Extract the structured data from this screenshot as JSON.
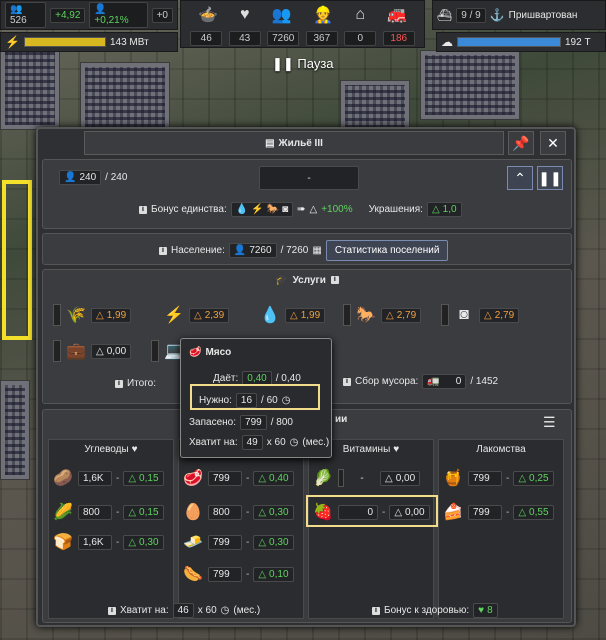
{
  "hud_left": {
    "items": [
      {
        "icon": "people-icon",
        "value": "526"
      },
      {
        "icon": "",
        "value": "+4,92"
      },
      {
        "icon": "person-icon",
        "value": "+0,21%"
      },
      {
        "icon": "",
        "value": "+0"
      }
    ],
    "power_value": "143 МВт"
  },
  "hud_center": {
    "icons": [
      "food-bowl-icon",
      "heart-icon",
      "people-group-icon",
      "worker-icon",
      "house-icon",
      "fire-truck-icon"
    ],
    "values": [
      "46",
      "43",
      "7260",
      "367",
      "0",
      "186"
    ]
  },
  "hud_right": {
    "ship_count": "9 / 9",
    "ship_status": "Пришвартован",
    "water_value": "192 Т"
  },
  "pause_label": "Пауза",
  "window": {
    "title": "Жильё III",
    "residents": "240",
    "residents_max": "/ 240",
    "name_field": "-",
    "unity_label": "Бонус единства:",
    "unity_value": "+100%",
    "decor_label": "Украшения:",
    "decor_value": "1,0",
    "population_label": "Население:",
    "population_value": "7260",
    "population_max": "/ 7260",
    "stats_button": "Статистика поселений",
    "services_title": "Услуги",
    "services": [
      {
        "icon": "grain-icon",
        "value": "1,99",
        "color": "orange"
      },
      {
        "icon": "lightning-icon",
        "value": "2,39",
        "color": "orange"
      },
      {
        "icon": "water-drops-icon",
        "value": "1,99",
        "color": "orange"
      },
      {
        "icon": "rocking-horse-icon",
        "value": "2,79",
        "color": "orange"
      },
      {
        "icon": "washing-machine-icon",
        "value": "2,79",
        "color": "orange"
      },
      {
        "icon": "medical-bag-icon",
        "value": "0,00",
        "color": "white"
      },
      {
        "icon": "laptop-icon",
        "value": "",
        "color": "white"
      }
    ],
    "total_label": "Итого:",
    "garbage_label": "Сбор мусора:",
    "garbage_value": "0",
    "garbage_max": "/ 1452",
    "food_title_tail": "ии",
    "food_columns": [
      {
        "title": "Углеводы",
        "rows": [
          {
            "icon": "potato-icon",
            "stock": "1,6K",
            "val": "0,15",
            "color": "green"
          },
          {
            "icon": "corn-icon",
            "stock": "800",
            "val": "0,15",
            "color": "green"
          },
          {
            "icon": "bread-icon",
            "stock": "1,6K",
            "val": "0,30",
            "color": "green"
          }
        ]
      },
      {
        "title": "",
        "rows": [
          {
            "icon": "meat-icon",
            "stock": "799",
            "val": "0,40",
            "color": "green"
          },
          {
            "icon": "eggs-icon",
            "stock": "800",
            "val": "0,30",
            "color": "green"
          },
          {
            "icon": "tofu-icon",
            "stock": "799",
            "val": "0,30",
            "color": "green"
          },
          {
            "icon": "sausage-icon",
            "stock": "799",
            "val": "0,10",
            "color": "green"
          }
        ]
      },
      {
        "title": "Витамины",
        "rows": [
          {
            "icon": "vegetables-icon",
            "stock": "-",
            "val": "0,00",
            "color": "white"
          },
          {
            "icon": "fruit-icon",
            "stock": "0",
            "val": "0,00",
            "color": "white"
          }
        ]
      },
      {
        "title": "Лакомства",
        "rows": [
          {
            "icon": "jam-icon",
            "stock": "799",
            "val": "0,25",
            "color": "green"
          },
          {
            "icon": "cake-icon",
            "stock": "799",
            "val": "0,55",
            "color": "green"
          }
        ]
      }
    ],
    "lasts_label": "Хватит на:",
    "lasts_value": "46",
    "lasts_max": "x 60",
    "lasts_unit": "(мес.)",
    "health_label": "Бонус к здоровью:",
    "health_value": "8"
  },
  "tooltip": {
    "title": "Мясо",
    "given_label": "Даёт:",
    "given_value": "0,40",
    "given_max": "/ 0,40",
    "needed_label": "Нужно:",
    "needed_value": "16",
    "needed_max": "/ 60",
    "stored_label": "Запасено:",
    "stored_value": "799",
    "stored_max": "/ 800",
    "lasts_label": "Хватит на:",
    "lasts_value": "49",
    "lasts_max": "x 60",
    "lasts_unit": "(мес.)"
  }
}
